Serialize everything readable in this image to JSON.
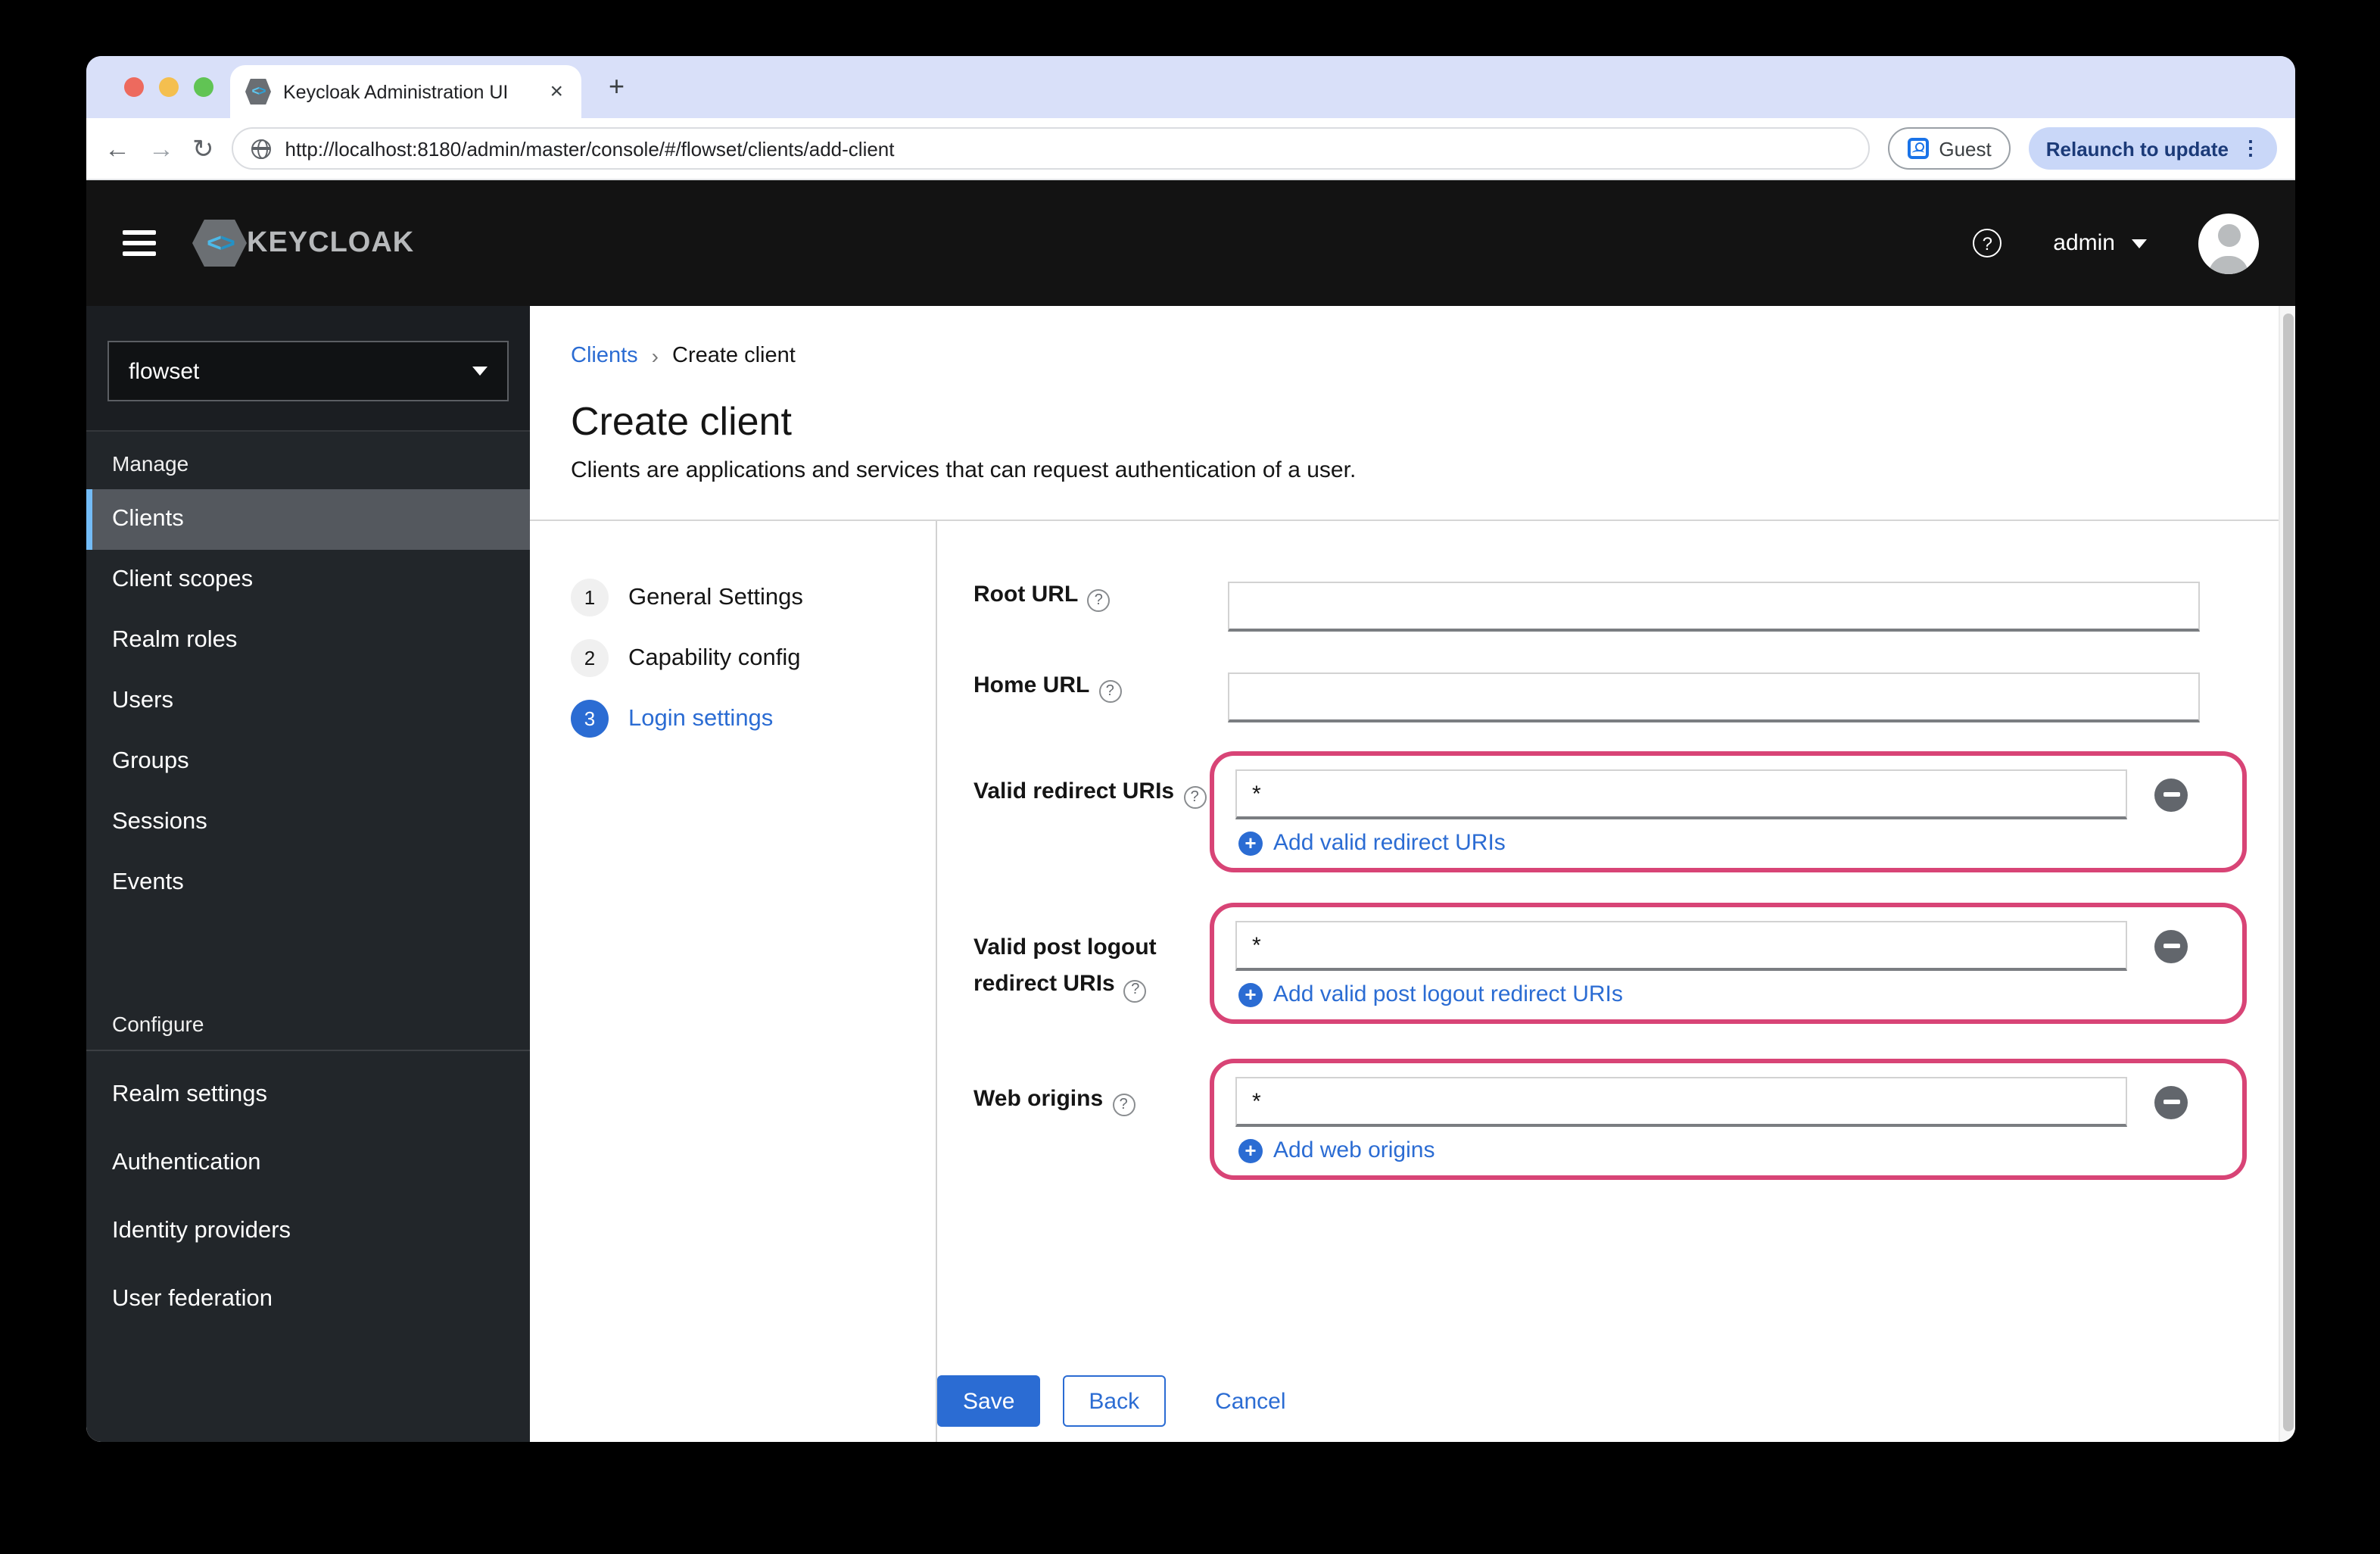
{
  "browser": {
    "tab_title": "Keycloak Administration UI",
    "url": "http://localhost:8180/admin/master/console/#/flowset/clients/add-client",
    "guest_label": "Guest",
    "relaunch_label": "Relaunch to update"
  },
  "masthead": {
    "brand": "KEYCLOAK",
    "user": "admin"
  },
  "sidebar": {
    "realm": "flowset",
    "sections": [
      {
        "label": "Manage",
        "items": [
          {
            "label": "Clients",
            "active": true
          },
          {
            "label": "Client scopes"
          },
          {
            "label": "Realm roles"
          },
          {
            "label": "Users"
          },
          {
            "label": "Groups"
          },
          {
            "label": "Sessions"
          },
          {
            "label": "Events"
          }
        ]
      },
      {
        "label": "Configure",
        "items": [
          {
            "label": "Realm settings"
          },
          {
            "label": "Authentication"
          },
          {
            "label": "Identity providers"
          },
          {
            "label": "User federation"
          }
        ]
      }
    ]
  },
  "breadcrumb": {
    "parent": "Clients",
    "current": "Create client"
  },
  "page": {
    "title": "Create client",
    "description": "Clients are applications and services that can request authentication of a user."
  },
  "wizard": {
    "steps": [
      {
        "num": "1",
        "label": "General Settings"
      },
      {
        "num": "2",
        "label": "Capability config"
      },
      {
        "num": "3",
        "label": "Login settings",
        "active": true
      }
    ]
  },
  "form": {
    "root_url": {
      "label": "Root URL",
      "value": ""
    },
    "home_url": {
      "label": "Home URL",
      "value": ""
    },
    "valid_redirect_uris": {
      "label": "Valid redirect URIs",
      "value": "*",
      "add_label": "Add valid redirect URIs"
    },
    "valid_post_logout_redirect_uris": {
      "label_line1": "Valid post logout",
      "label_line2": "redirect URIs",
      "value": "*",
      "add_label": "Add valid post logout redirect URIs"
    },
    "web_origins": {
      "label": "Web origins",
      "value": "*",
      "add_label": "Add web origins"
    }
  },
  "actions": {
    "save": "Save",
    "back": "Back",
    "cancel": "Cancel"
  },
  "colors": {
    "accent_blue": "#2b6cd3",
    "highlight_pink": "#d84476",
    "masthead_bg": "#131313",
    "sidebar_bg": "#22262a",
    "active_item_bar": "#73bcf7",
    "tabstrip_bg": "#d9e0f9"
  }
}
